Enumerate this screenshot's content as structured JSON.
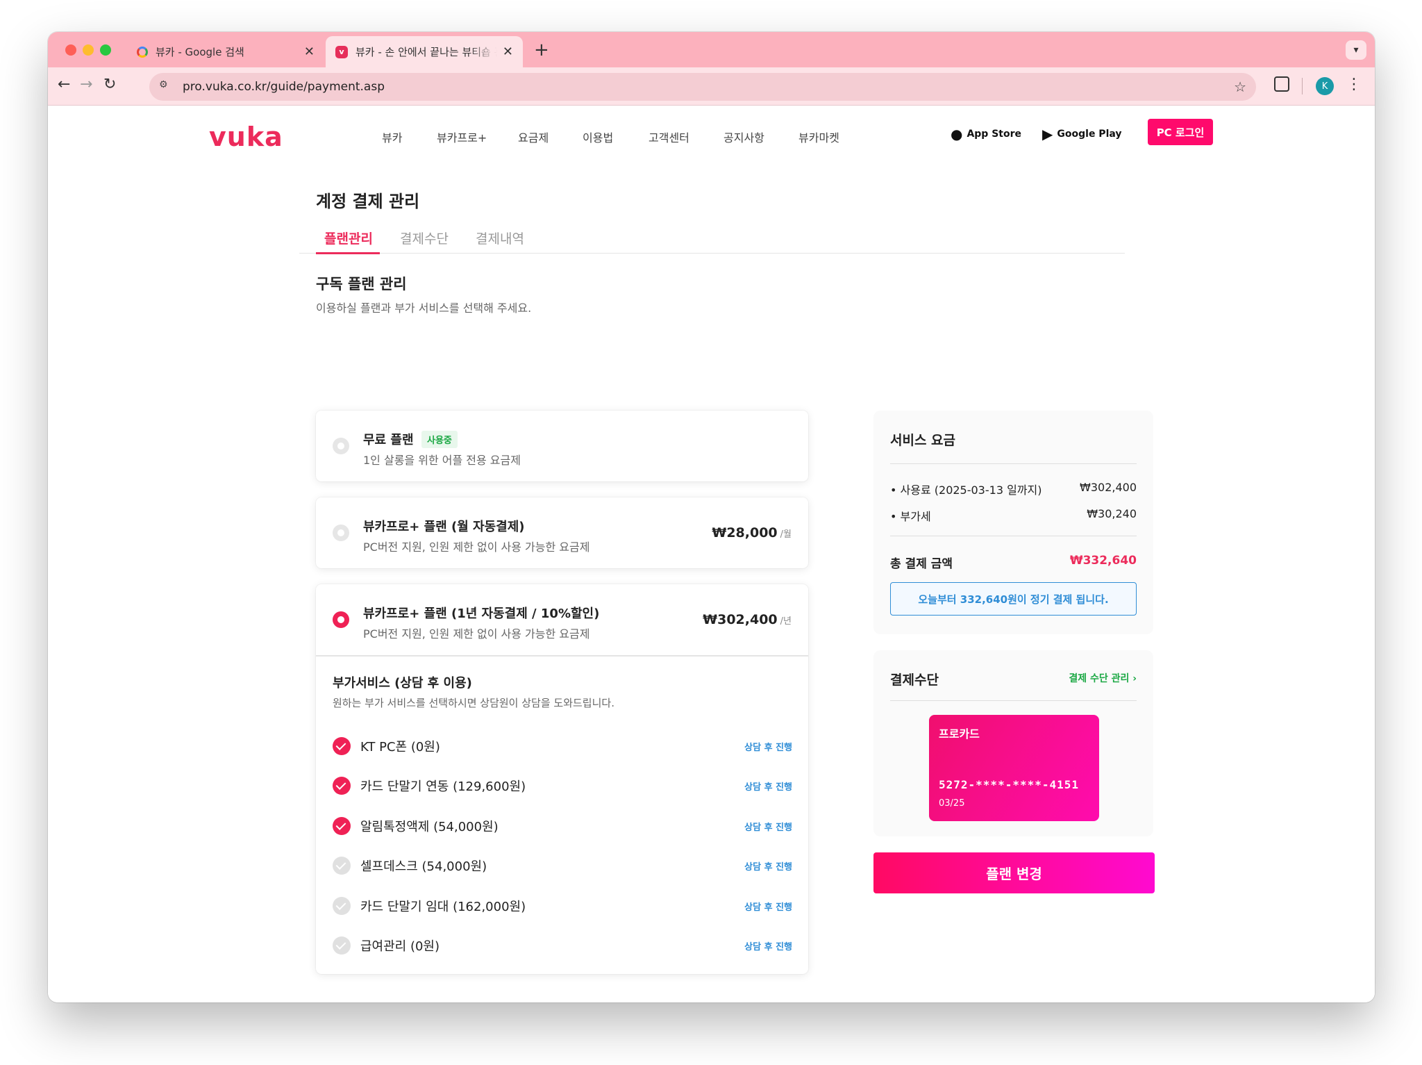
{
  "browser": {
    "tabs": [
      {
        "title": "뷰카 - Google 검색",
        "active": false
      },
      {
        "title": "뷰카 - 손 안에서 끝나는 뷰티숍 관리",
        "active": true
      }
    ],
    "new_tab": "+",
    "tab_menu": "⌄",
    "url": "pro.vuka.co.kr/guide/payment.asp",
    "profile_initial": "K"
  },
  "header": {
    "logo": "vuka",
    "nav": [
      "뷰카",
      "뷰카프로+",
      "요금제",
      "이용법",
      "고객센터",
      "공지사항",
      "뷰카마켓"
    ],
    "app_store": "App Store",
    "google_play": "Google Play",
    "login": "PC 로그인"
  },
  "page": {
    "title": "계정 결제 관리",
    "tabs": [
      "플랜관리",
      "결제수단",
      "결제내역"
    ],
    "active_tab": "플랜관리"
  },
  "plan_section": {
    "title": "구독 플랜 관리",
    "subtitle": "이용하실 플랜과 부가 서비스를 선택해 주세요.",
    "plans": [
      {
        "name": "무료 플랜",
        "badge": "사용중",
        "desc": "1인 살롱을 위한 어플 전용 요금제",
        "selected": false
      },
      {
        "name": "뷰카프로+ 플랜 (월 자동결제)",
        "desc": "PC버전 지원, 인원 제한 없이 사용 가능한 요금제",
        "price": "₩28,000",
        "unit": "/월",
        "selected": false
      },
      {
        "name": "뷰카프로+ 플랜 (1년 자동결제 / 10%할인)",
        "desc": "PC버전 지원, 인원 제한 없이 사용 가능한 요금제",
        "price": "₩302,400",
        "unit": "/년",
        "selected": true
      }
    ],
    "addons": {
      "title": "부가서비스 (상담 후 이용)",
      "subtitle": "원하는 부가 서비스를 선택하시면 상담원이 상담을 도와드립니다.",
      "items": [
        {
          "label": "KT PC폰 (0원)",
          "checked": true,
          "link": "상담 후 진행"
        },
        {
          "label": "카드 단말기 연동 (129,600원)",
          "checked": true,
          "link": "상담 후 진행"
        },
        {
          "label": "알림톡정액제 (54,000원)",
          "checked": true,
          "link": "상담 후 진행"
        },
        {
          "label": "셀프데스크 (54,000원)",
          "checked": false,
          "link": "상담 후 진행"
        },
        {
          "label": "카드 단말기 임대 (162,000원)",
          "checked": false,
          "link": "상담 후 진행"
        },
        {
          "label": "급여관리 (0원)",
          "checked": false,
          "link": "상담 후 진행"
        }
      ]
    }
  },
  "service_fee": {
    "title": "서비스 요금",
    "rows": [
      {
        "label": "• 사용료 (2025-03-13 일까지)",
        "value": "₩302,400"
      },
      {
        "label": "• 부가세",
        "value": "₩30,240"
      }
    ],
    "total_label": "총 결제 금액",
    "total_value": "₩332,640",
    "notice": "오늘부터 332,640원이 정기 결제 됩니다."
  },
  "payment_method": {
    "title": "결제수단",
    "manage_link": "결제 수단 관리 ›",
    "card_name": "프로카드",
    "card_number": "5272-****-****-4151",
    "card_expiry": "03/25"
  },
  "change_button": "플랜 변경",
  "colors": {
    "brand": "#ec2b5b",
    "accent_pink": "#ff0a6c",
    "link_blue": "#2f8dd6",
    "badge_green": "#1ba844",
    "tabbar": "#fcb1bd"
  }
}
